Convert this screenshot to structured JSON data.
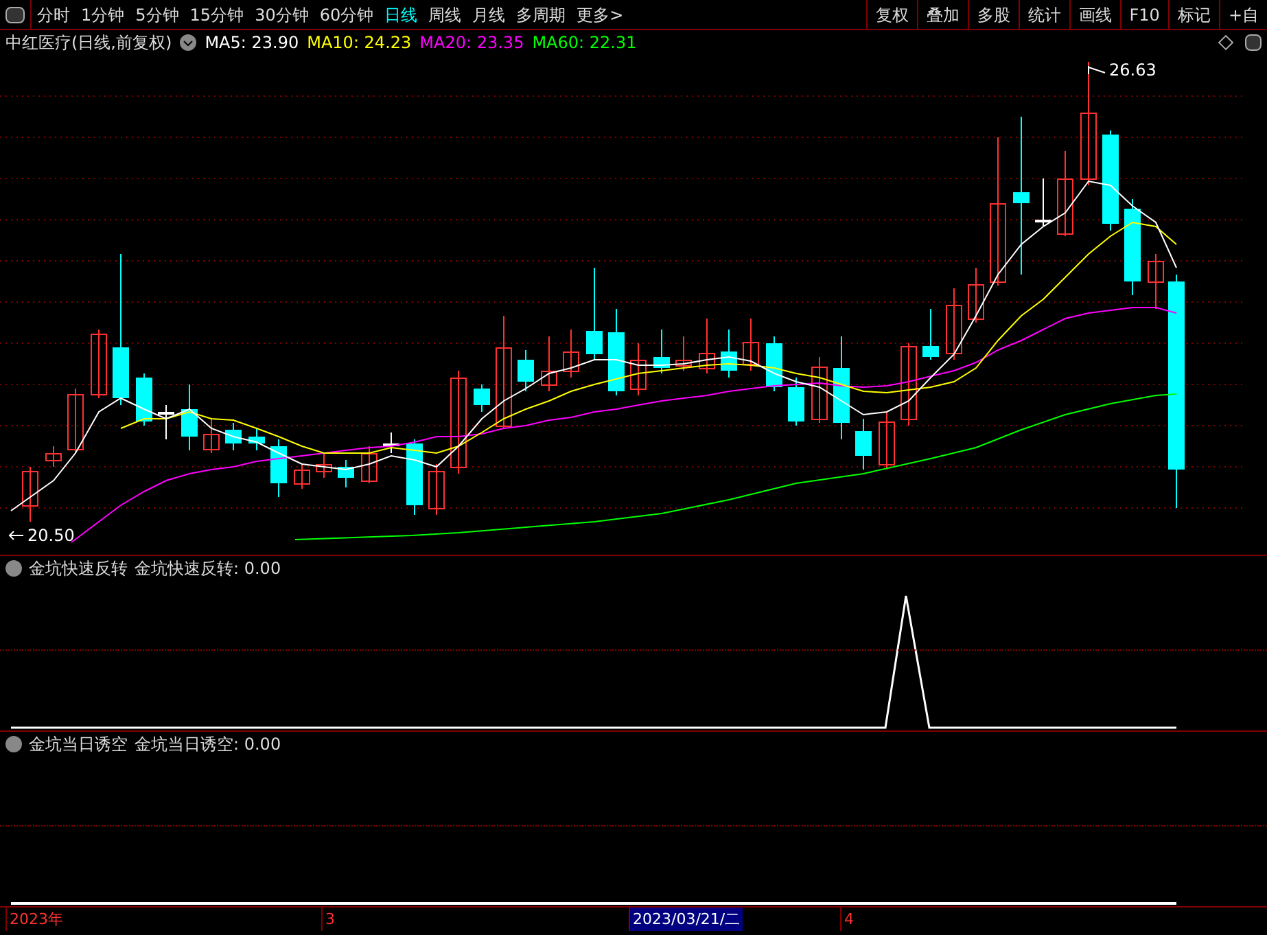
{
  "toolbar": {
    "periods": [
      {
        "label": "分时",
        "selected": false
      },
      {
        "label": "1分钟",
        "selected": false
      },
      {
        "label": "5分钟",
        "selected": false
      },
      {
        "label": "15分钟",
        "selected": false
      },
      {
        "label": "30分钟",
        "selected": false
      },
      {
        "label": "60分钟",
        "selected": false
      },
      {
        "label": "日线",
        "selected": true
      },
      {
        "label": "周线",
        "selected": false
      },
      {
        "label": "月线",
        "selected": false
      },
      {
        "label": "多周期",
        "selected": false
      },
      {
        "label": "更多>",
        "selected": false
      }
    ],
    "actions": [
      "复权",
      "叠加",
      "多股",
      "统计",
      "画线",
      "F10",
      "标记",
      "+自"
    ]
  },
  "chart": {
    "title": "中红医疗(日线,前复权)",
    "ma": [
      {
        "label": "MA5: 23.90",
        "color": "#ffffff"
      },
      {
        "label": "MA10: 24.23",
        "color": "#ffff00"
      },
      {
        "label": "MA20: 23.35",
        "color": "#ff00ff"
      },
      {
        "label": "MA60: 22.31",
        "color": "#00ff00"
      }
    ],
    "high_label": "26.63",
    "low_label": "20.50"
  },
  "indicators": [
    {
      "name": "金坑快速反转",
      "reading": "金坑快速反转: 0.00"
    },
    {
      "name": "金坑当日诱空",
      "reading": "金坑当日诱空: 0.00"
    }
  ],
  "date_axis": [
    {
      "label": "2023年",
      "selected": false
    },
    {
      "label": "3",
      "selected": false
    },
    {
      "label": "2023/03/21/二",
      "selected": true
    },
    {
      "label": "4",
      "selected": false
    }
  ]
}
